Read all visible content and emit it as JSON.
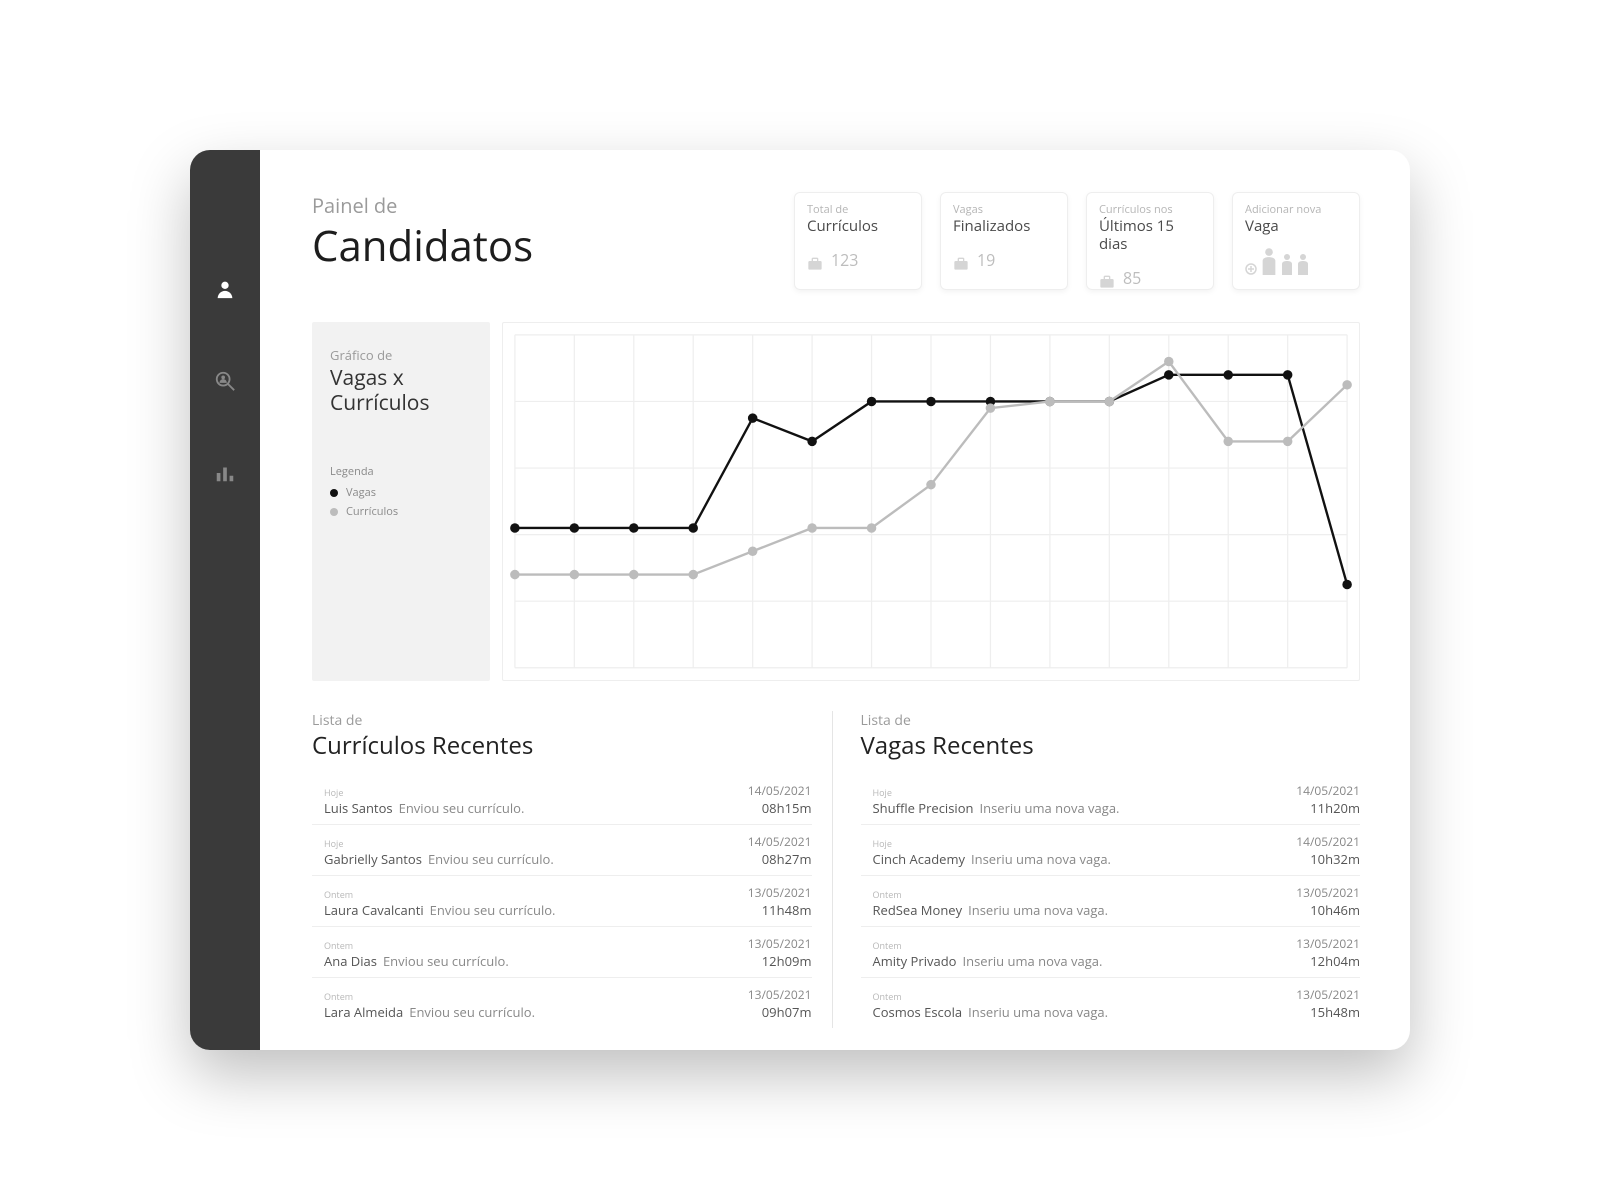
{
  "sidebar": {
    "items": [
      {
        "name": "user-icon",
        "active": true
      },
      {
        "name": "search-user-icon",
        "active": false
      },
      {
        "name": "bar-chart-icon",
        "active": false
      }
    ]
  },
  "header": {
    "super": "Painel de",
    "title": "Candidatos"
  },
  "cards": [
    {
      "super": "Total de",
      "title": "Currículos",
      "value": "123",
      "icon": "briefcase"
    },
    {
      "super": "Vagas",
      "title": "Finalizados",
      "value": "19",
      "icon": "briefcase"
    },
    {
      "super": "Currículos nos",
      "title": "Últimos 15 dias",
      "value": "85",
      "icon": "briefcase"
    },
    {
      "super": "Adicionar nova",
      "title": "Vaga",
      "action": true
    }
  ],
  "chart_panel": {
    "super": "Gráfico de",
    "title": "Vagas x Currículos",
    "legend_header": "Legenda",
    "legend": [
      {
        "label": "Vagas",
        "color": "#111"
      },
      {
        "label": "Currículos",
        "color": "#bcbcbc"
      }
    ]
  },
  "chart_data": {
    "type": "line",
    "x": [
      1,
      2,
      3,
      4,
      5,
      6,
      7,
      8,
      9,
      10,
      11,
      12,
      13,
      14,
      15
    ],
    "ylim": [
      0,
      100
    ],
    "series": [
      {
        "name": "Vagas",
        "color": "#111",
        "values": [
          42,
          42,
          42,
          42,
          75,
          68,
          80,
          80,
          80,
          80,
          80,
          88,
          88,
          88,
          25
        ]
      },
      {
        "name": "Currículos",
        "color": "#bcbcbc",
        "values": [
          28,
          28,
          28,
          28,
          35,
          42,
          42,
          55,
          78,
          80,
          80,
          92,
          68,
          68,
          85
        ]
      }
    ]
  },
  "lists": {
    "curriculos": {
      "super": "Lista de",
      "title": "Currículos Recentes",
      "items": [
        {
          "when": "Hoje",
          "who": "Luis Santos",
          "action": "Enviou seu currículo.",
          "date": "14/05/2021",
          "time": "08h15m"
        },
        {
          "when": "Hoje",
          "who": "Gabrielly Santos",
          "action": "Enviou seu currículo.",
          "date": "14/05/2021",
          "time": "08h27m"
        },
        {
          "when": "Ontem",
          "who": "Laura Cavalcanti",
          "action": "Enviou seu currículo.",
          "date": "13/05/2021",
          "time": "11h48m"
        },
        {
          "when": "Ontem",
          "who": "Ana Dias",
          "action": "Enviou seu currículo.",
          "date": "13/05/2021",
          "time": "12h09m"
        },
        {
          "when": "Ontem",
          "who": "Lara Almeida",
          "action": "Enviou seu currículo.",
          "date": "13/05/2021",
          "time": "09h07m"
        }
      ]
    },
    "vagas": {
      "super": "Lista de",
      "title": "Vagas Recentes",
      "items": [
        {
          "when": "Hoje",
          "who": "Shuffle Precision",
          "action": "Inseriu uma nova vaga.",
          "date": "14/05/2021",
          "time": "11h20m"
        },
        {
          "when": "Hoje",
          "who": "Cinch Academy",
          "action": "Inseriu uma nova vaga.",
          "date": "14/05/2021",
          "time": "10h32m"
        },
        {
          "when": "Ontem",
          "who": "RedSea Money",
          "action": "Inseriu uma nova vaga.",
          "date": "13/05/2021",
          "time": "10h46m"
        },
        {
          "when": "Ontem",
          "who": "Amity Privado",
          "action": "Inseriu uma nova vaga.",
          "date": "13/05/2021",
          "time": "12h04m"
        },
        {
          "when": "Ontem",
          "who": "Cosmos Escola",
          "action": "Inseriu uma nova vaga.",
          "date": "13/05/2021",
          "time": "15h48m"
        }
      ]
    }
  }
}
